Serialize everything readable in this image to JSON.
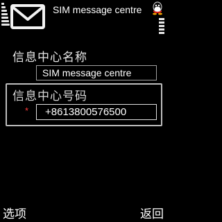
{
  "header": {
    "title": "SIM message centre",
    "icon": "envelope-icon",
    "status_icons": [
      "signal-bars-icon",
      "qq-icon",
      "battery-icon"
    ]
  },
  "form": {
    "name_label": "信息中心名称",
    "name_value": "SIM message centre",
    "number_label": "信息中心号码",
    "required_mark": "*",
    "number_value": "+8613800576500"
  },
  "softkeys": {
    "left": "选项",
    "right": "返回"
  },
  "colors": {
    "background": "#000000",
    "text": "#ffffff",
    "required": "#ff3b3b",
    "border": "#a0a0a0"
  }
}
